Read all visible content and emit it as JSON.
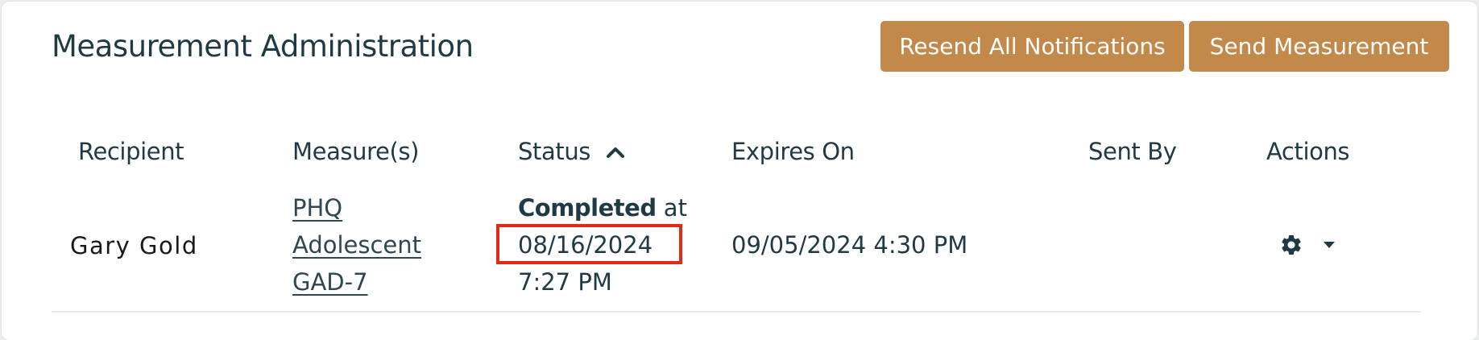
{
  "header": {
    "title": "Measurement Administration",
    "resend_all_label": "Resend All Notifications",
    "send_measurement_label": "Send Measurement"
  },
  "table": {
    "columns": {
      "recipient": "Recipient",
      "measures": "Measure(s)",
      "status": "Status",
      "expires_on": "Expires On",
      "sent_by": "Sent By",
      "actions": "Actions"
    },
    "sort": {
      "column": "Status",
      "icon": "chevron-up-icon"
    },
    "rows": [
      {
        "recipient": "Gary Gold",
        "measures": [
          "PHQ",
          "Adolescent",
          "GAD-7"
        ],
        "status": {
          "state": "Completed",
          "connector": " at",
          "date": "08/16/2024",
          "time": "7:27 PM"
        },
        "expires_on": "09/05/2024 4:30 PM",
        "sent_by": "",
        "actions": {
          "icon": "gear-icon",
          "dropdown_icon": "caret-down-icon"
        }
      }
    ]
  },
  "colors": {
    "button_bg": "#c2894b",
    "title_text": "#1f3a45",
    "highlight_border": "#e32a17"
  }
}
